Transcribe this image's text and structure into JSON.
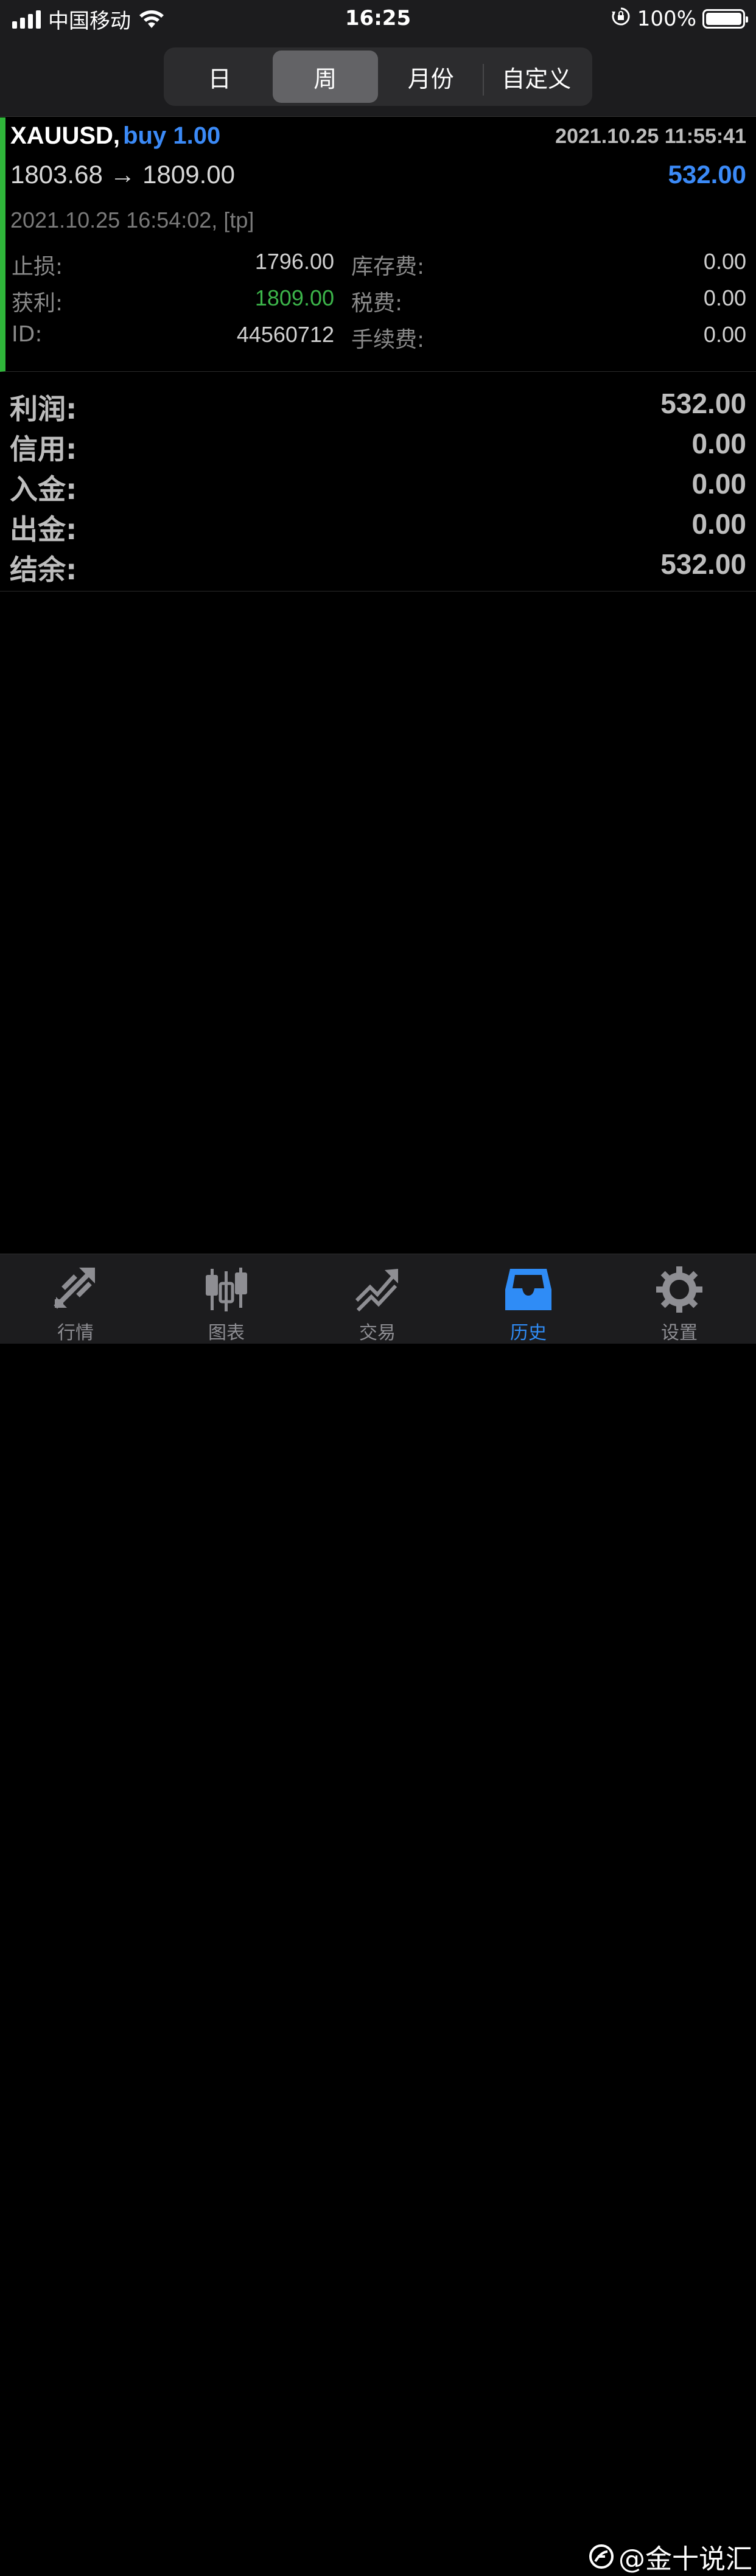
{
  "status_bar": {
    "carrier": "中国移动",
    "time": "16:25",
    "battery": "100%"
  },
  "period_tabs": {
    "items": [
      "日",
      "周",
      "月份",
      "自定义"
    ],
    "selected": "周"
  },
  "trade": {
    "symbol": "XAUUSD,",
    "action": "buy 1.00",
    "open_time": "2021.10.25 11:55:41",
    "prices": "1803.68 → 1809.00",
    "profit": "532.00",
    "close_info": "2021.10.25 16:54:02, [tp]",
    "details": [
      {
        "label": "止损:",
        "value": "1796.00",
        "label2": "库存费:",
        "value2": "0.00"
      },
      {
        "label": "获利:",
        "value": "1809.00",
        "label2": "税费:",
        "value2": "0.00"
      },
      {
        "label": "ID:",
        "value": "44560712",
        "label2": "手续费:",
        "value2": "0.00"
      }
    ],
    "accent_color": "#2fb53a"
  },
  "summary": [
    {
      "label": "利润:",
      "value": "532.00"
    },
    {
      "label": "信用:",
      "value": "0.00"
    },
    {
      "label": "入金:",
      "value": "0.00"
    },
    {
      "label": "出金:",
      "value": "0.00"
    },
    {
      "label": "结余:",
      "value": "532.00"
    }
  ],
  "tab_bar": {
    "items": [
      {
        "label": "行情",
        "icon": "quotes-arrows-icon"
      },
      {
        "label": "图表",
        "icon": "candlestick-chart-icon"
      },
      {
        "label": "交易",
        "icon": "trade-trend-icon"
      },
      {
        "label": "历史",
        "icon": "history-inbox-icon"
      },
      {
        "label": "设置",
        "icon": "gear-icon"
      }
    ],
    "active": "历史",
    "active_color": "#2f8cf6"
  },
  "watermark": "@金十说汇"
}
